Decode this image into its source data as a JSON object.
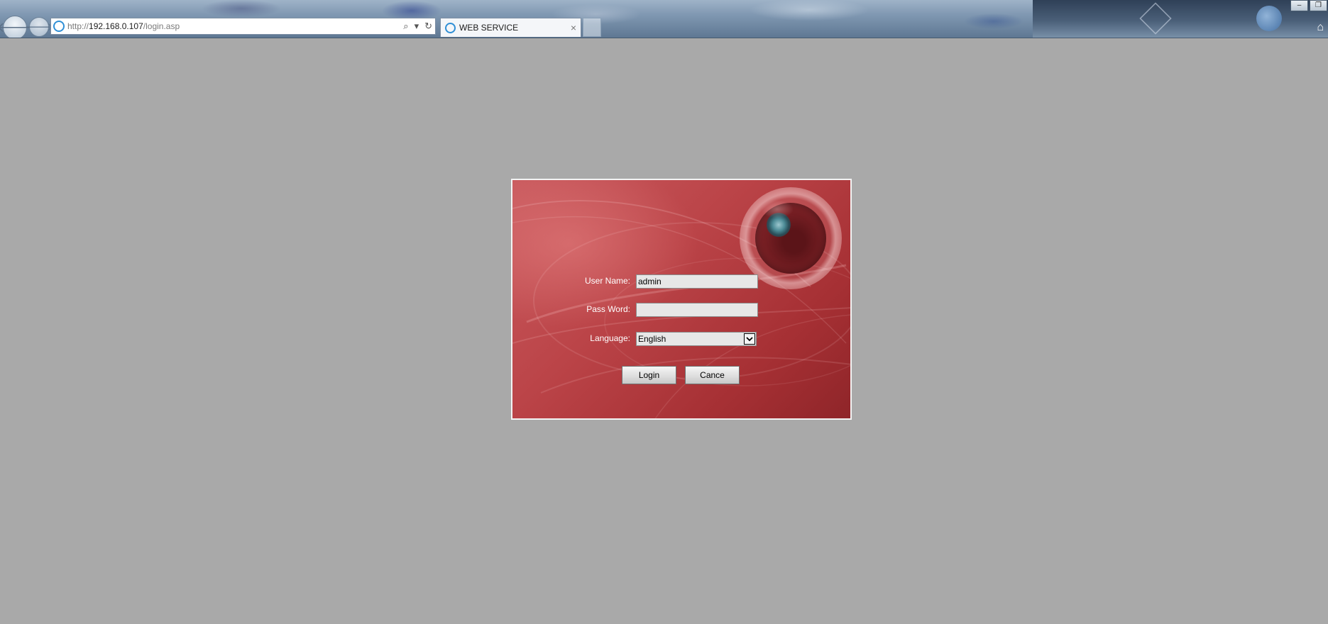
{
  "browser": {
    "url_prefix": "http://",
    "url_host": "192.168.0.107",
    "url_path": "/login.asp",
    "tab_title": "WEB SERVICE",
    "tab_close": "×",
    "back_icon": "🡐",
    "forward_icon": "🡒",
    "search_icon": "⌕",
    "dropdown_icon": "▾",
    "refresh_icon": "↻",
    "home_icon": "⌂",
    "minimize_icon": "–",
    "restore_icon": "❐"
  },
  "login": {
    "username_label": "User Name:",
    "username_value": "admin",
    "password_label": "Pass Word:",
    "password_value": "",
    "language_label": "Language:",
    "language_value": "English",
    "login_button": "Login",
    "cancel_button": "Cance"
  },
  "colors": {
    "page_background": "#a9a9a9",
    "panel_red": "#b03a3e",
    "panel_border": "#f3f3f3",
    "input_background": "#e7e7e7"
  }
}
